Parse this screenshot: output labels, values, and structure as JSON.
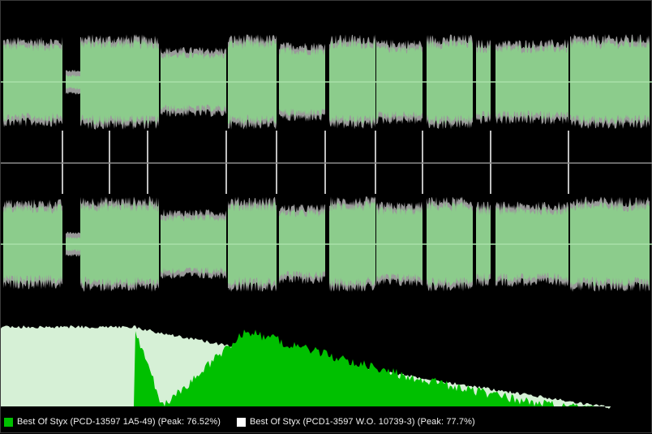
{
  "legend": {
    "track_a": {
      "label": "Best Of Styx (PCD-13597 1A5-49) (Peak: 76.52%)",
      "color": "#00c000"
    },
    "track_b": {
      "label": "Best Of Styx (PCD1-3597 W.O. 10739-3) (Peak: 77.7%)",
      "color": "#ffffff"
    }
  },
  "colors": {
    "background": "#000000",
    "wave_fill": "#8ccc8c",
    "wave_alt": "#9a9a9a",
    "wave_green": "#24c024",
    "center_line": "#a9e0a9",
    "divider_line": "#8a8a8a",
    "marker": "#ffffff",
    "spectrum_a": "#00c000",
    "spectrum_b": "#d6f0d6"
  },
  "icons": [
    "legend-swatch-green",
    "legend-swatch-white"
  ]
}
